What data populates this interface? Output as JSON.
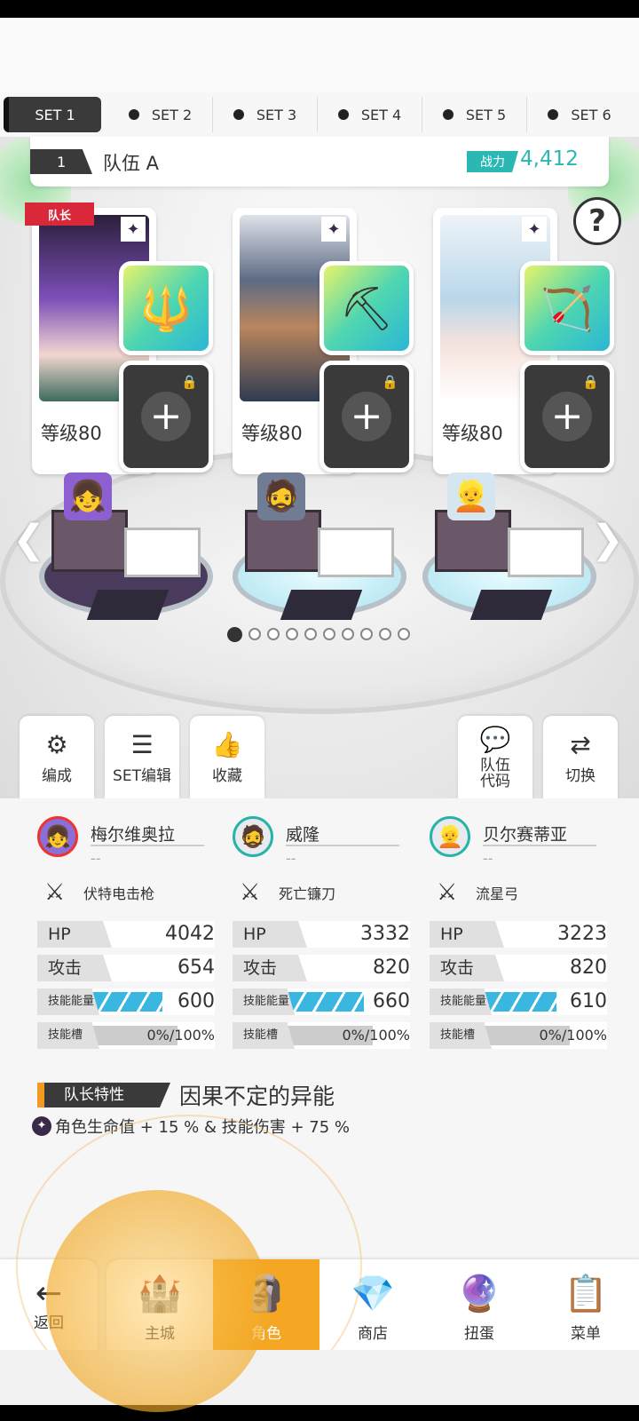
{
  "set_tabs": [
    {
      "label": "SET 1",
      "active": true
    },
    {
      "label": "SET 2",
      "active": false
    },
    {
      "label": "SET 3",
      "active": false
    },
    {
      "label": "SET 4",
      "active": false
    },
    {
      "label": "SET 5",
      "active": false
    },
    {
      "label": "SET 6",
      "active": false
    }
  ],
  "team": {
    "number": "1",
    "name": "队伍 A",
    "power_label": "战力",
    "power_value": "4,412"
  },
  "help_label": "?",
  "captain_badge": "队长",
  "characters": [
    {
      "level": "等级80",
      "weapon_icon": "trident-icon",
      "art_color": "#7c4fb8",
      "sprite_color": "#8c60d0"
    },
    {
      "level": "等级80",
      "weapon_icon": "pickaxe-icon",
      "art_color": "#5d6b84",
      "sprite_color": "#6f7c94"
    },
    {
      "level": "等级80",
      "weapon_icon": "bow-icon",
      "art_color": "#b9d7ea",
      "sprite_color": "#d6e6f0"
    }
  ],
  "pager": {
    "count": 10,
    "active_index": 0
  },
  "actions": {
    "formation": "编成",
    "set_edit": "SET编辑",
    "favorite": "收藏",
    "team_code": "队伍\n代码",
    "switch": "切换"
  },
  "stats": [
    {
      "name": "梅尔维奥拉",
      "sub": "--",
      "weapon": "伏特电击枪",
      "hp_label": "HP",
      "hp": "4042",
      "atk_label": "攻击",
      "atk": "654",
      "skill_energy_label": "技能能量",
      "skill_energy": "600",
      "skill_slot_label": "技能槽",
      "skill_slot": "0%/100%",
      "energy_fill": 0.82
    },
    {
      "name": "威隆",
      "sub": "--",
      "weapon": "死亡镰刀",
      "hp_label": "HP",
      "hp": "3332",
      "atk_label": "攻击",
      "atk": "820",
      "skill_energy_label": "技能能量",
      "skill_energy": "660",
      "skill_slot_label": "技能槽",
      "skill_slot": "0%/100%",
      "energy_fill": 0.9
    },
    {
      "name": "贝尔赛蒂亚",
      "sub": "--",
      "weapon": "流星弓",
      "hp_label": "HP",
      "hp": "3223",
      "atk_label": "攻击",
      "atk": "820",
      "skill_energy_label": "技能能量",
      "skill_energy": "610",
      "skill_slot_label": "技能槽",
      "skill_slot": "0%/100%",
      "energy_fill": 0.84
    }
  ],
  "leader": {
    "tag": "队长特性",
    "title": "因果不定的异能",
    "desc": "角色生命值 + 15 % & 技能伤害 + 75 %"
  },
  "nav": {
    "back": "返回",
    "tabs": [
      {
        "label": "主城",
        "icon": "castle-icon",
        "active": false
      },
      {
        "label": "角色",
        "icon": "character-icon",
        "active": true
      },
      {
        "label": "商店",
        "icon": "shop-icon",
        "active": false
      },
      {
        "label": "扭蛋",
        "icon": "gacha-icon",
        "active": false
      },
      {
        "label": "菜单",
        "icon": "menu-icon",
        "active": false
      }
    ]
  }
}
